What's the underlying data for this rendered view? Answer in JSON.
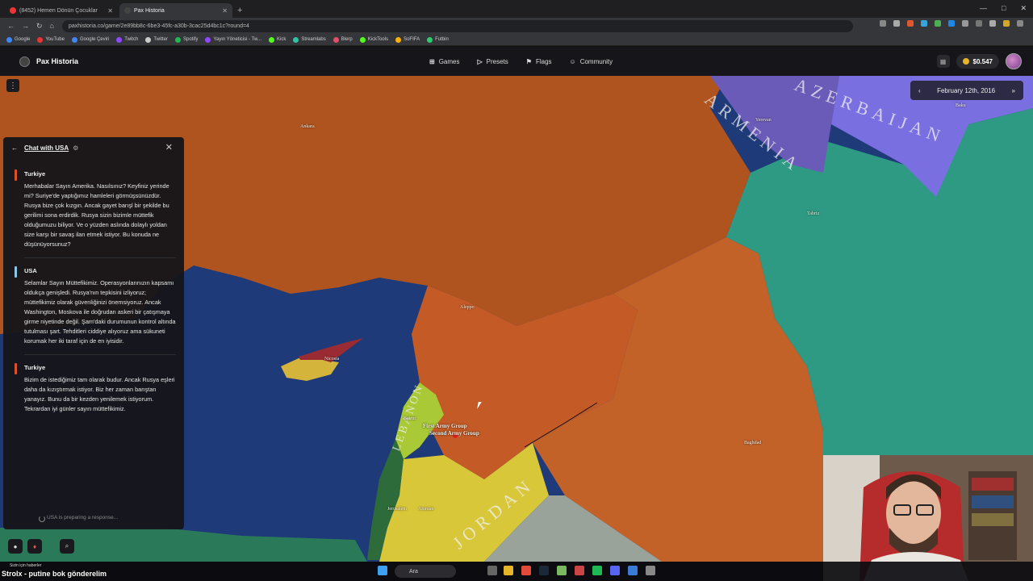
{
  "browser": {
    "tabs": [
      {
        "label": "(8452) Hemen Dönün Çocuklar",
        "active": false
      },
      {
        "label": "Pax Historia",
        "active": true
      }
    ],
    "url": "paxhistoria.co/game/2e89bb8c-6be3-45fc-a30b-3cac25d4bc1c?round=4",
    "bookmarks": [
      "Google",
      "YouTube",
      "Google Çeviri",
      "Twitch",
      "Twitter",
      "Spotify",
      "Yayın Yöneticisi - Tw...",
      "Kick",
      "Streamlabs",
      "Blerp",
      "KickTools",
      "SoFIFA",
      "Futbin"
    ]
  },
  "app": {
    "brand": "Pax Historia",
    "nav": [
      "Games",
      "Presets",
      "Flags",
      "Community"
    ],
    "balance": "$0.547",
    "date": "February 12th, 2016"
  },
  "chat": {
    "title": "Chat with USA",
    "messages": [
      {
        "from": "Turkiye",
        "text": "Merhabalar Sayın Amerika. Nasılsınız? Keyfiniz yerinde mi? Suriye'de yaptığımız hamleleri görmüşsünüzdür. Rusya bize çok kızgın. Ancak gayet barışl bir şekilde bu gerilimi sona erdirdik. Rusya sizin bizimle müttefik olduğumuzu biliyor. Ve o yüzden aslında dolaylı yoldan size karşı bir savaş ilan etmek istiyor. Bu konuda ne düşünüyorsunuz?"
      },
      {
        "from": "USA",
        "text": "Selamlar Sayın Müttefikimiz. Operasyonlarınızın kapsamı oldukça genişledi. Rusya'nın tepkisini izliyoruz; müttefikimiz olarak güvenliğinizi önemsiyoruz. Ancak Washington, Moskova ile doğrudan askeri bir çatışmaya girme niyetinde değil. Şam'daki durumunun kontrol altında tutulması şart. Tehditleri ciddiye alıyoruz ama sükuneti korumak her iki taraf için de en iyisidir."
      },
      {
        "from": "Turkiye",
        "text": "Bizim de istediğimiz tam olarak budur. Ancak Rusya eşleri daha da kızıştırmak istiyor. Biz her zaman barıştan yanayız. Bunu da bir kezden yenilemek istiyorum. Tekrardan iyi günler sayın müttefikimiz."
      }
    ],
    "status": "USA is preparing a response..."
  },
  "map": {
    "country_labels": [
      "ARMENIA",
      "AZERBAIJAN",
      "LEBANON",
      "JORDAN"
    ],
    "city_labels": [
      "Ankara",
      "Nicosia",
      "Aleppo",
      "Baghdad",
      "Yerevan",
      "Baku",
      "Tabriz",
      "Amman",
      "Jerusalem",
      "Beirut"
    ],
    "unit_labels": [
      "First Army Group",
      "Second Army Group"
    ],
    "colors": {
      "sea": "#1e3a78",
      "turkey": "#b0541f",
      "syria": "#c45a26",
      "iraq": "#c26229",
      "iran": "#2f9a84",
      "armenia": "#6b5bb8",
      "azerbaijan": "#7a6fe0",
      "lebanon": "#a9c936",
      "jordan": "#d9c73a",
      "israel": "#2e6b3a",
      "cyprus": "#d4b43a",
      "n_cyprus": "#9b2b32"
    }
  },
  "stream": {
    "ticker": "Strolx - putine bok gönderelim",
    "ticker_small": "Sizin için haberler",
    "taskbar_search": "Ara"
  }
}
